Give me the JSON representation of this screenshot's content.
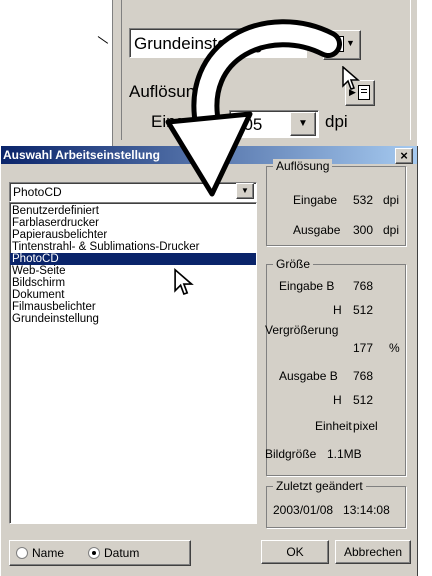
{
  "bg_window": {
    "preset_field_text": "Grundeinstellung",
    "resolution_label": "Auflösung",
    "input_label": "Eingabe",
    "input_value": "705",
    "unit": "dpi"
  },
  "dialog": {
    "title": "Auswahl Arbeitseinstellung",
    "close": "×",
    "combo_value": "PhotoCD",
    "list_items": [
      "Benutzerdefiniert",
      "Farblaserdrucker",
      "Papierausbelichter",
      "Tintenstrahl- & Sublimations-Drucker",
      "PhotoCD",
      "Web-Seite",
      "Bildschirm",
      "Dokument",
      "Filmausbelichter",
      "Grundeinstellung"
    ],
    "selected_index": 4,
    "resolution": {
      "title": "Auflösung",
      "input_label": "Eingabe",
      "input_value": "532",
      "input_unit": "dpi",
      "output_label": "Ausgabe",
      "output_value": "300",
      "output_unit": "dpi"
    },
    "size": {
      "title": "Größe",
      "input_w_label": "Eingabe B",
      "input_w": "768",
      "input_h_label": "H",
      "input_h": "512",
      "magnification_label": "Vergrößerung",
      "magnification": "177",
      "percent": "%",
      "output_w_label": "Ausgabe B",
      "output_w": "768",
      "output_h_label": "H",
      "output_h": "512",
      "unit_label": "Einheit",
      "unit": "pixel",
      "filesize_label": "Bildgröße",
      "filesize": "1.1MB"
    },
    "changed": {
      "title": "Zuletzt geändert",
      "value": "2003/01/08   13:14:08"
    },
    "sort": {
      "name_label": "Name",
      "date_label": "Datum",
      "selected": "Datum"
    },
    "ok_label": "OK",
    "cancel_label": "Abbrechen"
  },
  "colors": {
    "title_bar": "#0a246a",
    "selection": "#0a246a",
    "face": "#d4d0c8"
  }
}
